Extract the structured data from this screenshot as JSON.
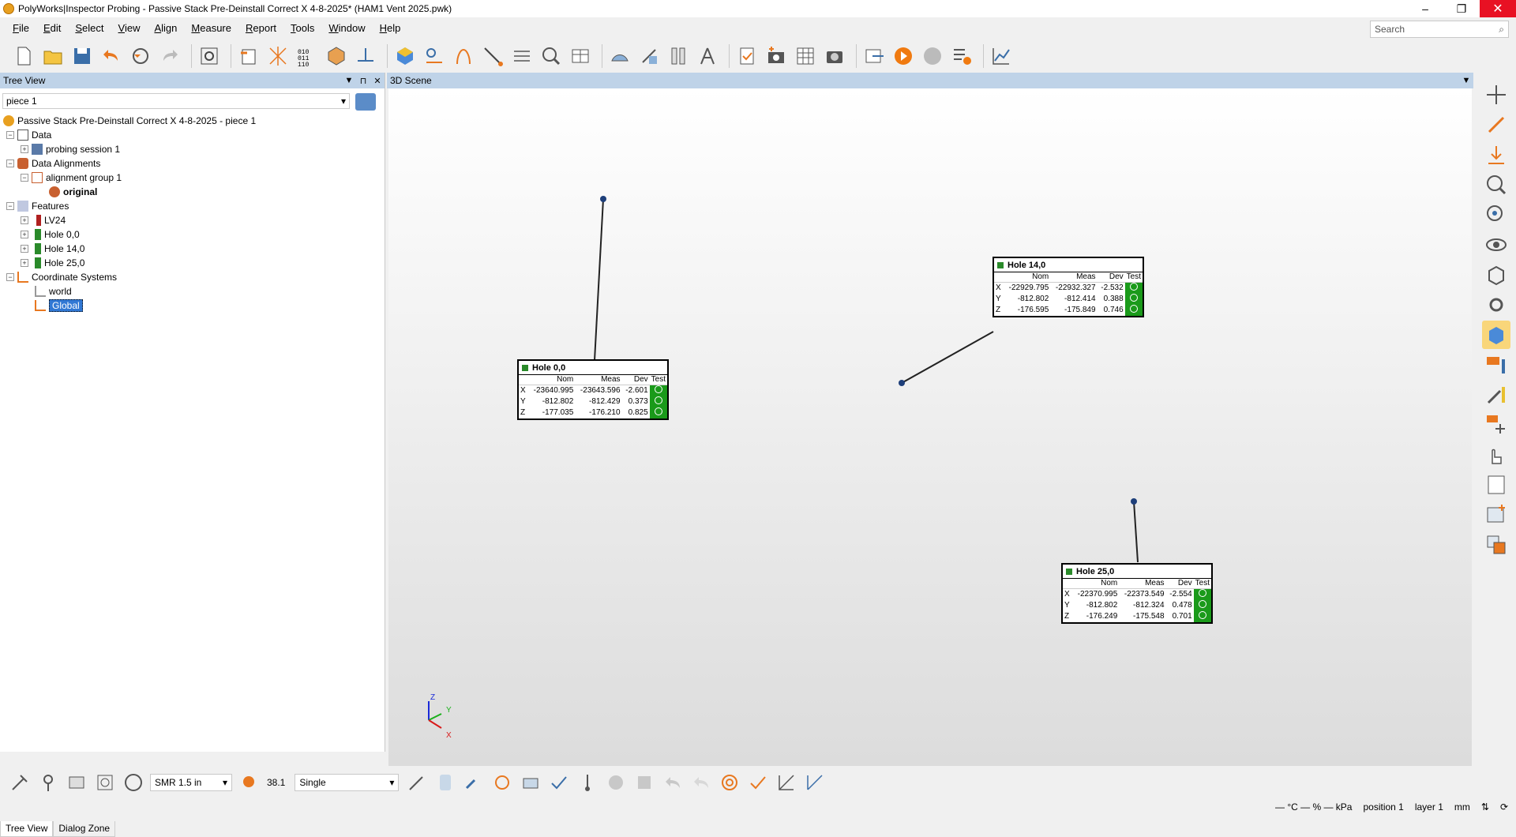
{
  "window": {
    "title": "PolyWorks|Inspector Probing - Passive Stack Pre-Deinstall Correct X 4-8-2025* (HAM1 Vent 2025.pwk)",
    "minimize": "–",
    "restore": "❐",
    "close": "✕"
  },
  "menu": [
    {
      "key": "F",
      "rest": "ile"
    },
    {
      "key": "E",
      "rest": "dit"
    },
    {
      "key": "S",
      "rest": "elect"
    },
    {
      "key": "V",
      "rest": "iew"
    },
    {
      "key": "A",
      "rest": "lign"
    },
    {
      "key": "M",
      "rest": "easure"
    },
    {
      "key": "R",
      "rest": "eport"
    },
    {
      "key": "T",
      "rest": "ools"
    },
    {
      "key": "W",
      "rest": "indow"
    },
    {
      "key": "H",
      "rest": "elp"
    }
  ],
  "search": {
    "placeholder": "Search"
  },
  "tree_panel": {
    "title": "Tree View",
    "piece": "piece 1",
    "nodes": [
      {
        "label": "Passive Stack Pre-Deinstall Correct X 4-8-2025 - piece 1"
      },
      {
        "label": "Data"
      },
      {
        "label": "probing session 1"
      },
      {
        "label": "Data Alignments"
      },
      {
        "label": "alignment group 1"
      },
      {
        "label": "original"
      },
      {
        "label": "Features"
      },
      {
        "label": "LV24"
      },
      {
        "label": "Hole 0,0"
      },
      {
        "label": "Hole 14,0"
      },
      {
        "label": "Hole 25,0"
      },
      {
        "label": "Coordinate Systems"
      },
      {
        "label": "world"
      },
      {
        "label": "Global"
      }
    ],
    "tabs": [
      "Tree View",
      "Dialog Zone"
    ]
  },
  "scene": {
    "title": "3D Scene",
    "callouts": [
      {
        "name": "Hole 0,0",
        "headers": [
          "",
          "Nom",
          "Meas",
          "Dev",
          "Test"
        ],
        "rows": [
          {
            "axis": "X",
            "nom": "-23640.995",
            "meas": "-23643.596",
            "dev": "-2.601"
          },
          {
            "axis": "Y",
            "nom": "-812.802",
            "meas": "-812.429",
            "dev": "0.373"
          },
          {
            "axis": "Z",
            "nom": "-177.035",
            "meas": "-176.210",
            "dev": "0.825"
          }
        ]
      },
      {
        "name": "Hole 14,0",
        "headers": [
          "",
          "Nom",
          "Meas",
          "Dev",
          "Test"
        ],
        "rows": [
          {
            "axis": "X",
            "nom": "-22929.795",
            "meas": "-22932.327",
            "dev": "-2.532"
          },
          {
            "axis": "Y",
            "nom": "-812.802",
            "meas": "-812.414",
            "dev": "0.388"
          },
          {
            "axis": "Z",
            "nom": "-176.595",
            "meas": "-175.849",
            "dev": "0.746"
          }
        ]
      },
      {
        "name": "Hole 25,0",
        "headers": [
          "",
          "Nom",
          "Meas",
          "Dev",
          "Test"
        ],
        "rows": [
          {
            "axis": "X",
            "nom": "-22370.995",
            "meas": "-22373.549",
            "dev": "-2.554"
          },
          {
            "axis": "Y",
            "nom": "-812.802",
            "meas": "-812.324",
            "dev": "0.478"
          },
          {
            "axis": "Z",
            "nom": "-176.249",
            "meas": "-175.548",
            "dev": "0.701"
          }
        ]
      }
    ],
    "axis_labels": {
      "x": "X",
      "y": "Y",
      "z": "Z"
    }
  },
  "bottom_toolbar": {
    "probe": "SMR 1.5 in",
    "probe_diameter": "38.1",
    "mode": "Single"
  },
  "status": {
    "env": "— °C — % — kPa",
    "position": "position 1",
    "layer": "layer 1",
    "units": "mm"
  },
  "colors": {
    "panel_header": "#bfd3e8",
    "test_pass": "#1a9a1a",
    "selection": "#3178d4",
    "close": "#e81123"
  }
}
